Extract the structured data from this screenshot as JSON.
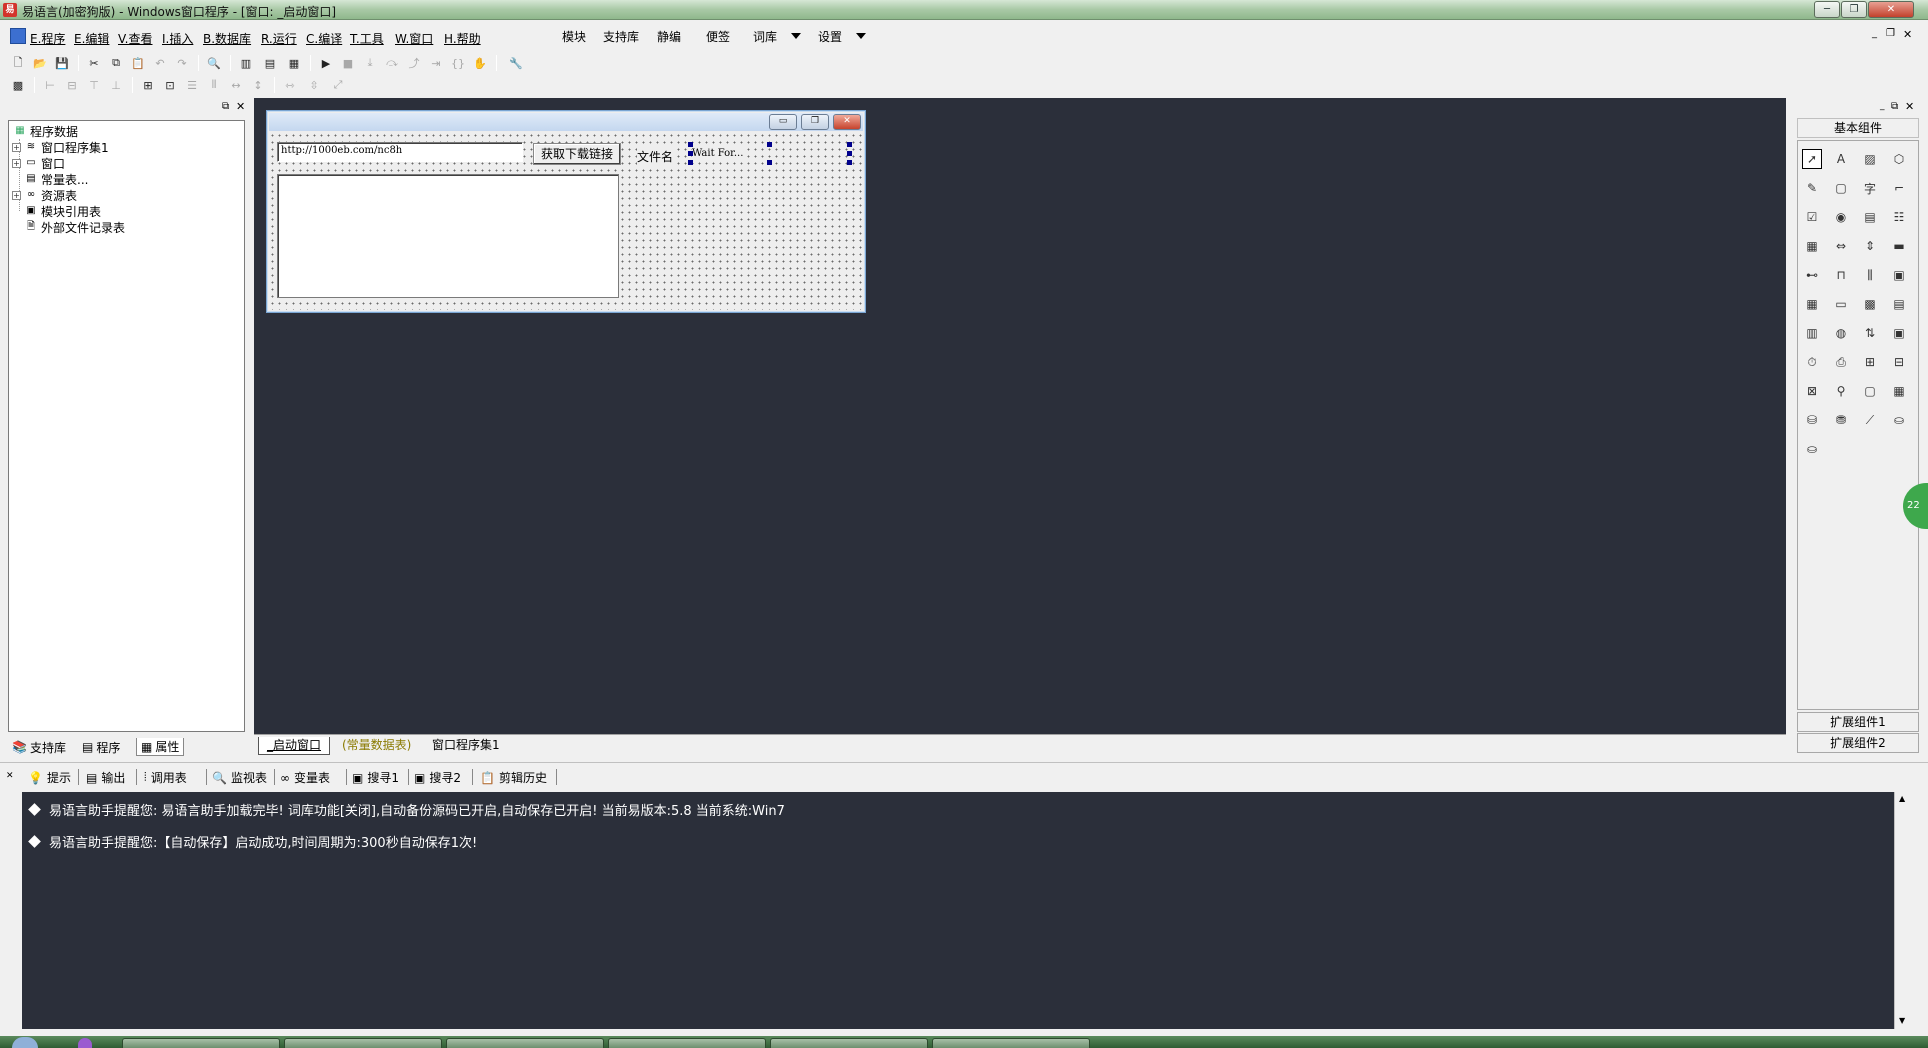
{
  "window": {
    "title": "易语言(加密狗版) - Windows窗口程序 - [窗口: _启动窗口]",
    "controls": {
      "minimize": "─",
      "restore": "❐",
      "close": "✕"
    }
  },
  "menubar": {
    "items": [
      "E.程序",
      "E.编辑",
      "V.查看",
      "I.插入",
      "B.数据库",
      "R.运行",
      "C.编译",
      "T.工具",
      "W.窗口",
      "H.帮助"
    ],
    "extras": [
      "模块",
      "支持库",
      "静编",
      "便签",
      "词库",
      "设置"
    ]
  },
  "left_panel": {
    "tree": {
      "root": "程序数据",
      "items": [
        "窗口程序集1",
        "窗口",
        "常量表...",
        "资源表",
        "模块引用表",
        "外部文件记录表"
      ]
    },
    "tabs": [
      "支持库",
      "程序",
      "属性"
    ]
  },
  "designer": {
    "url_value": "http://1000eb.com/nc8h",
    "get_link_button": "获取下载链接",
    "filename_label": "文件名",
    "wait_label": "Wait For..."
  },
  "doc_tabs": [
    "_启动窗口",
    "(常量数据表)",
    "窗口程序集1"
  ],
  "component_panel": {
    "header": "基本组件",
    "ext1": "扩展组件1",
    "ext2": "扩展组件2",
    "badge": "22"
  },
  "output_tabs": [
    "提示",
    "输出",
    "调用表",
    "监视表",
    "变量表",
    "搜寻1",
    "搜寻2",
    "剪辑历史"
  ],
  "output_lines": [
    "易语言助手提醒您:  易语言助手加载完毕!  词库功能[关闭],自动备份源码已开启,自动保存已开启!  当前易版本:5.8  当前系统:Win7",
    "易语言助手提醒您:【自动保存】启动成功,时间周期为:300秒自动保存1次!"
  ]
}
